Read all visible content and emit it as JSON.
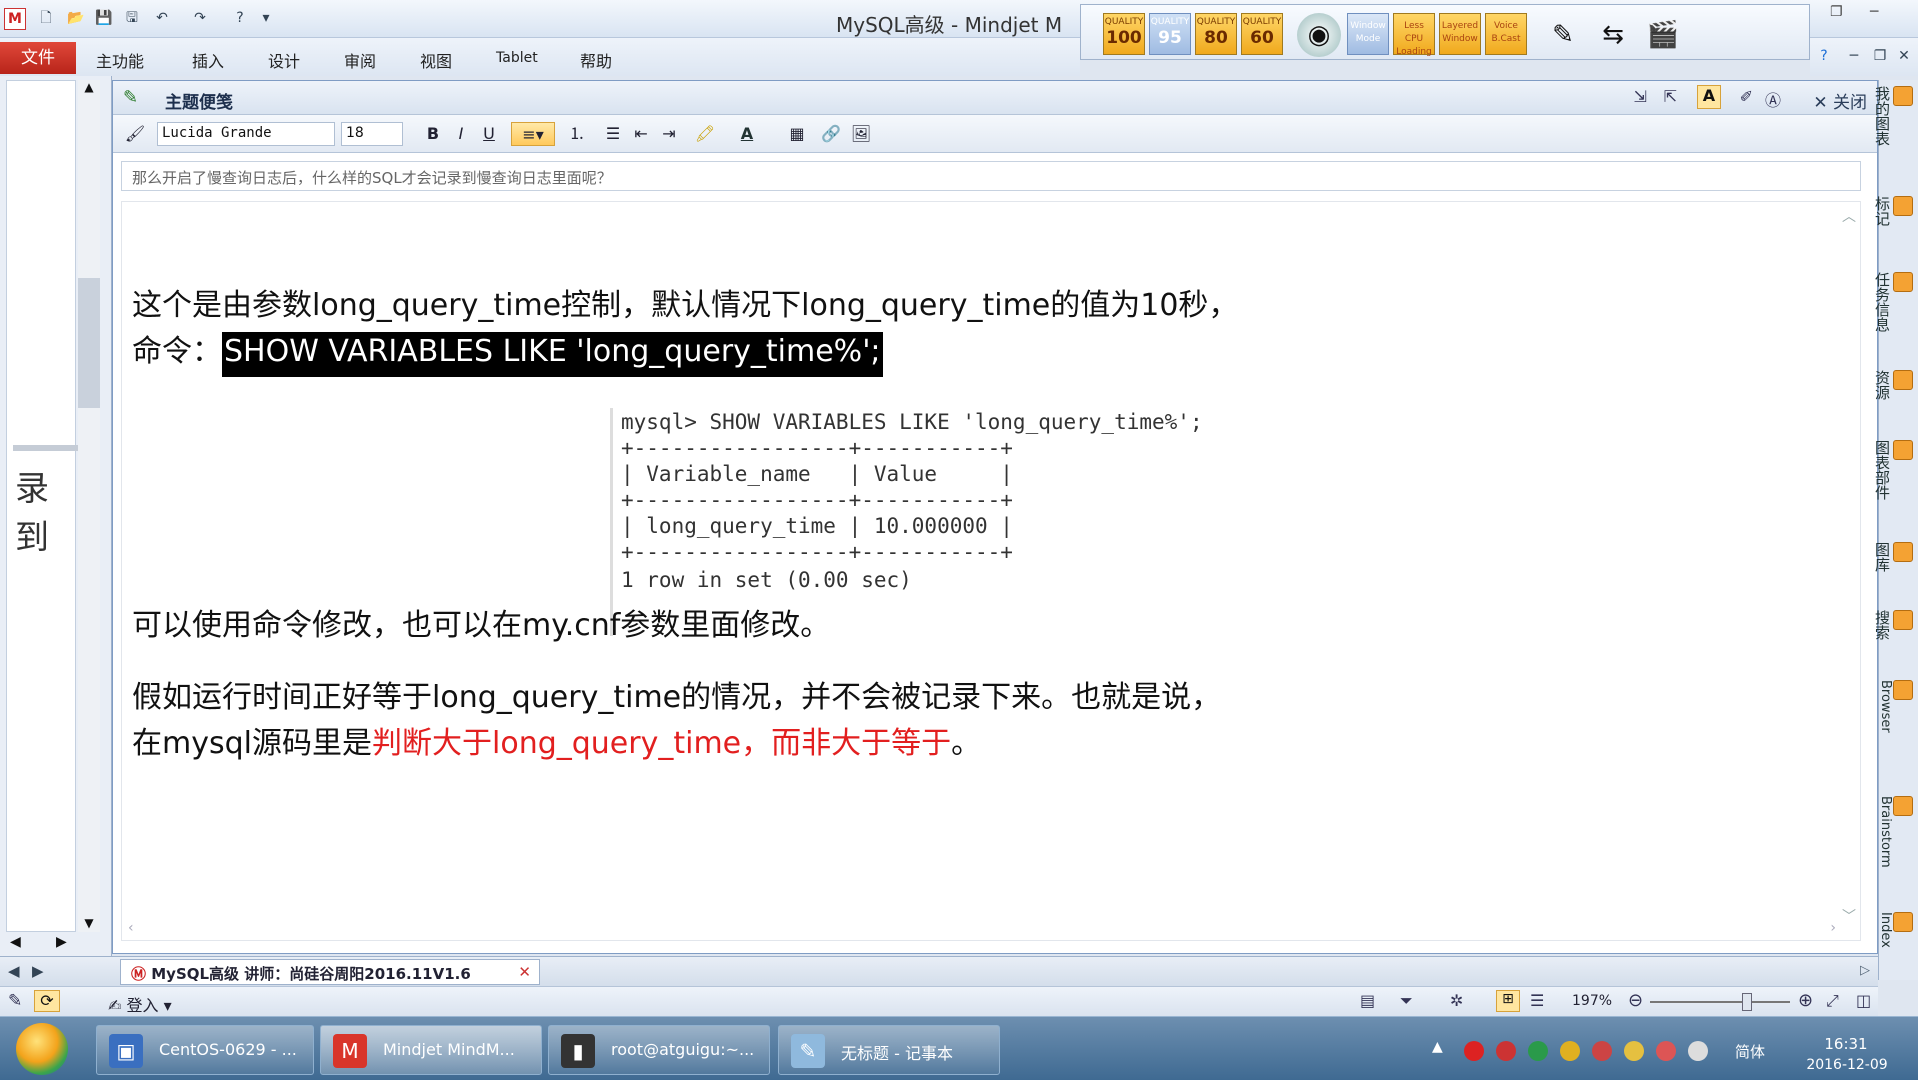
{
  "window": {
    "title": "MySQL高级 - Mindjet M",
    "quality_buttons": [
      {
        "top": "QUALITY",
        "value": "100"
      },
      {
        "top": "QUALITY",
        "value": "95"
      },
      {
        "top": "QUALITY",
        "value": "80"
      },
      {
        "top": "QUALITY",
        "value": "60"
      }
    ],
    "tool_buttons": [
      "Window Mode",
      "Less CPU Loading",
      "Layered Window",
      "Voice B.Cast"
    ]
  },
  "ribbon": {
    "tabs": [
      "文件",
      "主功能",
      "插入",
      "设计",
      "审阅",
      "视图",
      "Tablet",
      "帮助"
    ]
  },
  "left_pane": {
    "fragment_text": "录到"
  },
  "notes": {
    "title": "主题便笺",
    "close_label": "关闭",
    "font_name": "Lucida Grande",
    "font_size": "18",
    "topic_line": "那么开启了慢查询日志后，什么样的SQL才会记录到慢查询日志里面呢？",
    "paragraphs": {
      "p1": "这个是由参数long_query_time控制，默认情况下long_query_time的值为10秒，",
      "p2_prefix": "命令：",
      "p2_command": "SHOW VARIABLES LIKE 'long_query_time%';",
      "p3": "可以使用命令修改，也可以在my.cnf参数里面修改。",
      "p4": "假如运行时间正好等于long_query_time的情况，并不会被记录下来。也就是说，",
      "p5_prefix": "在mysql源码里是",
      "p5_red": "判断大于long_query_time，而非大于等于",
      "p5_suffix": "。"
    },
    "terminal": {
      "lines": [
        "mysql> SHOW VARIABLES LIKE 'long_query_time%';",
        "+-----------------+-----------+",
        "| Variable_name   | Value     |",
        "+-----------------+-----------+",
        "| long_query_time | 10.000000 |",
        "+-----------------+-----------+",
        "1 row in set (0.00 sec)"
      ]
    }
  },
  "right_bar": {
    "items": [
      "我的图表",
      "标记",
      "任务信息",
      "资源",
      "图表部件",
      "图库",
      "搜索",
      "Browser",
      "Brainstorm",
      "Index"
    ]
  },
  "doc_tab": {
    "label": "MySQL高级 讲师：尚硅谷周阳2016.11V1.6"
  },
  "status": {
    "login": "登入",
    "zoom": "197%"
  },
  "taskbar": {
    "tasks": [
      "CentOS-0629 - ...",
      "Mindjet MindM...",
      "root@atguigu:~...",
      "无标题 - 记事本"
    ],
    "ime": "简体",
    "time": "16:31",
    "date": "2016-12-09"
  },
  "colors": {
    "accent_red": "#e21f1f",
    "ribbon_file": "#c8281d",
    "taskbar": "#4f779e"
  }
}
